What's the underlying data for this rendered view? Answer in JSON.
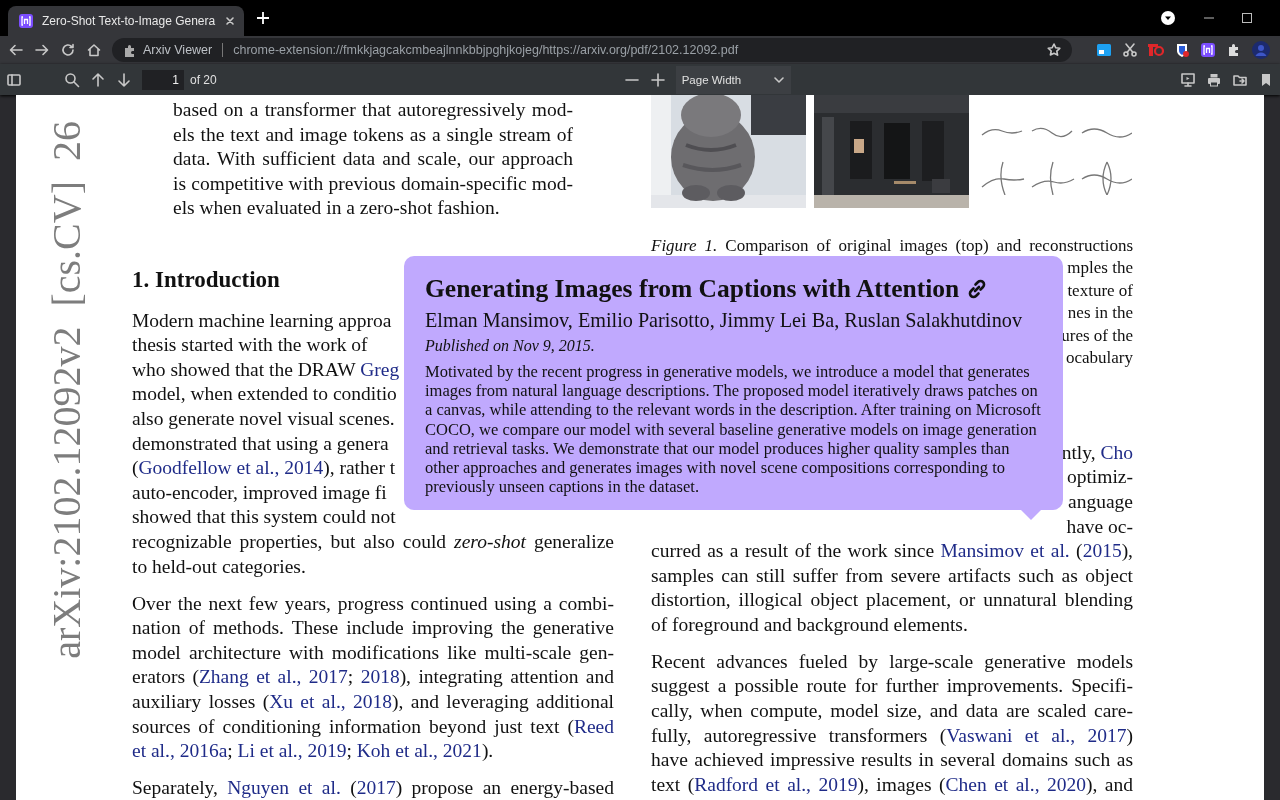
{
  "tab": {
    "title": "Zero-Shot Text-to-Image Genera"
  },
  "address_bar": {
    "label": "Arxiv Viewer",
    "url": "chrome-extension://fmkkjagcakcmbeajlnnkbbjpghjkojeg/https://arxiv.org/pdf/2102.12092.pdf"
  },
  "pdf_toolbar": {
    "page": "1",
    "page_count": "of 20",
    "zoom": "Page Width"
  },
  "document": {
    "side_label": "arXiv:2102.12092v2  [cs.CV]  26",
    "left_column": [
      {
        "kind": "abstract",
        "lines": [
          {
            "kind": "full",
            "parts": [
              {
                "kind": "text",
                "text": "based on a transformer that autoregressively mod-"
              }
            ]
          },
          {
            "kind": "full",
            "parts": [
              {
                "kind": "text",
                "text": "els the text and image tokens as a single stream of"
              }
            ]
          },
          {
            "kind": "full",
            "parts": [
              {
                "kind": "text",
                "text": "data. With sufficient data and scale, our approach"
              }
            ]
          },
          {
            "kind": "full",
            "parts": [
              {
                "kind": "text",
                "text": "is competitive with previous domain-specific mod-"
              }
            ]
          },
          {
            "kind": "last",
            "parts": [
              {
                "kind": "text",
                "text": "els when evaluated in a zero-shot fashion."
              }
            ]
          }
        ]
      },
      {
        "kind": "heading",
        "text": "1. Introduction"
      },
      {
        "kind": "paragraph",
        "lines": [
          {
            "kind": "cut_end",
            "parts": [
              {
                "kind": "text",
                "text": "Modern machine learning approa"
              }
            ]
          },
          {
            "kind": "cut_end",
            "parts": [
              {
                "kind": "text",
                "text": "thesis started with the work of"
              }
            ]
          },
          {
            "kind": "cut_end",
            "parts": [
              {
                "kind": "text",
                "text": "who showed that the DRAW "
              },
              {
                "kind": "link",
                "text": "Greg"
              }
            ]
          },
          {
            "kind": "cut_end",
            "parts": [
              {
                "kind": "text",
                "text": "model, when extended to conditio"
              }
            ]
          },
          {
            "kind": "cut_end",
            "parts": [
              {
                "kind": "text",
                "text": "also generate novel visual scenes."
              }
            ]
          },
          {
            "kind": "cut_end",
            "parts": [
              {
                "kind": "text",
                "text": "demonstrated that using a genera"
              }
            ]
          },
          {
            "kind": "cut_end",
            "parts": [
              {
                "kind": "text",
                "text": "("
              },
              {
                "kind": "link",
                "text": "Goodfellow et al., 2014"
              },
              {
                "kind": "text",
                "text": "), rather t"
              }
            ]
          },
          {
            "kind": "cut_end",
            "parts": [
              {
                "kind": "text",
                "text": "auto-encoder, improved image fi"
              }
            ]
          },
          {
            "kind": "cut_end",
            "parts": [
              {
                "kind": "text",
                "text": "showed that this system could not"
              }
            ]
          },
          {
            "kind": "full",
            "parts": [
              {
                "kind": "text",
                "text": "recognizable properties, but also could *zero-shot* generalize"
              }
            ]
          },
          {
            "kind": "last",
            "parts": [
              {
                "kind": "text",
                "text": "to held-out categories."
              }
            ]
          }
        ]
      },
      {
        "kind": "paragraph",
        "lines": [
          {
            "kind": "full",
            "parts": [
              {
                "kind": "text",
                "text": "Over the next few years, progress continued using a combi-"
              }
            ]
          },
          {
            "kind": "full",
            "parts": [
              {
                "kind": "text",
                "text": "nation of methods. These include improving the generative"
              }
            ]
          },
          {
            "kind": "full",
            "parts": [
              {
                "kind": "text",
                "text": "model architecture with modifications like multi-scale gen-"
              }
            ]
          },
          {
            "kind": "full",
            "parts": [
              {
                "kind": "text",
                "text": "erators ("
              },
              {
                "kind": "link",
                "text": "Zhang et al., 2017"
              },
              {
                "kind": "text",
                "text": "; "
              },
              {
                "kind": "link",
                "text": "2018"
              },
              {
                "kind": "text",
                "text": "), integrating attention and"
              }
            ]
          },
          {
            "kind": "full",
            "parts": [
              {
                "kind": "text",
                "text": "auxiliary losses ("
              },
              {
                "kind": "link",
                "text": "Xu et al., 2018"
              },
              {
                "kind": "text",
                "text": "), and leveraging additional"
              }
            ]
          },
          {
            "kind": "full",
            "parts": [
              {
                "kind": "text",
                "text": "sources of conditioning information beyond just text ("
              },
              {
                "kind": "link",
                "text": "Reed"
              }
            ]
          },
          {
            "kind": "last",
            "parts": [
              {
                "kind": "link",
                "text": "et al., 2016a"
              },
              {
                "kind": "text",
                "text": "; "
              },
              {
                "kind": "link",
                "text": "Li et al., 2019"
              },
              {
                "kind": "text",
                "text": "; "
              },
              {
                "kind": "link",
                "text": "Koh et al., 2021"
              },
              {
                "kind": "text",
                "text": ")."
              }
            ]
          }
        ]
      },
      {
        "kind": "paragraph",
        "lines": [
          {
            "kind": "full",
            "parts": [
              {
                "kind": "text",
                "text": "Separately, "
              },
              {
                "kind": "link",
                "text": "Nguyen et al."
              },
              {
                "kind": "text",
                "text": " ("
              },
              {
                "kind": "link",
                "text": "2017"
              },
              {
                "kind": "text",
                "text": ") propose an energy-based"
              }
            ]
          }
        ]
      }
    ],
    "right_column": [
      {
        "kind": "figure",
        "images": [
          {
            "kind": "picture"
          },
          {
            "kind": "picture"
          },
          {
            "kind": "drawing"
          }
        ]
      },
      {
        "kind": "caption",
        "lines": [
          {
            "kind": "full",
            "parts": [
              {
                "kind": "text",
                "text": "*Figure 1.* Comparison of original images (top) and reconstructions"
              }
            ]
          },
          {
            "kind": "cut_start",
            "parts": [
              {
                "kind": "text",
                "text": "mples the"
              }
            ]
          },
          {
            "kind": "cut_start",
            "parts": [
              {
                "kind": "text",
                "text": "texture of"
              }
            ]
          },
          {
            "kind": "cut_start",
            "parts": [
              {
                "kind": "text",
                "text": "nes in the"
              }
            ]
          },
          {
            "kind": "cut_start",
            "parts": [
              {
                "kind": "text",
                "text": "ures of the"
              }
            ]
          },
          {
            "kind": "cut_start",
            "parts": [
              {
                "kind": "text",
                "text": "ocabulary"
              }
            ]
          }
        ]
      },
      {
        "kind": "paragraph",
        "lines": [
          {
            "kind": "cut_start",
            "parts": [
              {
                "kind": "text",
                "text": "ntly, "
              },
              {
                "kind": "link",
                "text": "Cho"
              }
            ]
          },
          {
            "kind": "cut_start",
            "parts": [
              {
                "kind": "text",
                "text": "optimiz-"
              }
            ]
          },
          {
            "kind": "cut_start",
            "parts": [
              {
                "kind": "text",
                "text": "anguage"
              }
            ]
          },
          {
            "kind": "cut_start",
            "parts": [
              {
                "kind": "text",
                "text": "have oc-"
              }
            ]
          },
          {
            "kind": "full",
            "parts": [
              {
                "kind": "text",
                "text": "curred as a result of the work since "
              },
              {
                "kind": "link",
                "text": "Mansimov et al."
              },
              {
                "kind": "text",
                "text": " ("
              },
              {
                "kind": "link",
                "text": "2015"
              },
              {
                "kind": "text",
                "text": "),"
              }
            ]
          },
          {
            "kind": "full",
            "parts": [
              {
                "kind": "text",
                "text": "samples can still suffer from severe artifacts such as object"
              }
            ]
          },
          {
            "kind": "full",
            "parts": [
              {
                "kind": "text",
                "text": "distortion, illogical object placement, or unnatural blending"
              }
            ]
          },
          {
            "kind": "last",
            "parts": [
              {
                "kind": "text",
                "text": "of foreground and background elements."
              }
            ]
          }
        ]
      },
      {
        "kind": "paragraph",
        "lines": [
          {
            "kind": "full",
            "parts": [
              {
                "kind": "text",
                "text": "Recent advances fueled by large-scale generative models"
              }
            ]
          },
          {
            "kind": "full",
            "parts": [
              {
                "kind": "text",
                "text": "suggest a possible route for further improvements. Specifi-"
              }
            ]
          },
          {
            "kind": "full",
            "parts": [
              {
                "kind": "text",
                "text": "cally, when compute, model size, and data are scaled care-"
              }
            ]
          },
          {
            "kind": "full",
            "parts": [
              {
                "kind": "text",
                "text": "fully, autoregressive transformers ("
              },
              {
                "kind": "link",
                "text": "Vaswani et al., 2017"
              },
              {
                "kind": "text",
                "text": ")"
              }
            ]
          },
          {
            "kind": "full",
            "parts": [
              {
                "kind": "text",
                "text": "have achieved impressive results in several domains such as"
              }
            ]
          },
          {
            "kind": "full",
            "parts": [
              {
                "kind": "text",
                "text": "text ("
              },
              {
                "kind": "link",
                "text": "Radford et al., 2019"
              },
              {
                "kind": "text",
                "text": "), images ("
              },
              {
                "kind": "link",
                "text": "Chen et al., 2020"
              },
              {
                "kind": "text",
                "text": "), and"
              }
            ]
          }
        ]
      }
    ]
  },
  "popup": {
    "title": "Generating Images from Captions with Attention",
    "authors": "Elman Mansimov, Emilio Parisotto, Jimmy Lei Ba, Ruslan Salakhutdinov",
    "published": "Published on Nov 9, 2015.",
    "abstract": "Motivated by the recent progress in generative models, we introduce a model that generates images from natural language descriptions. The proposed model iteratively draws patches on a canvas, while attending to the relevant words in the description. After training on Microsoft COCO, we compare our model with several baseline generative models on image generation and retrieval tasks. We demonstrate that our model produces higher quality samples than other approaches and generates images with novel scene compositions corresponding to previously unseen captions in the dataset."
  }
}
